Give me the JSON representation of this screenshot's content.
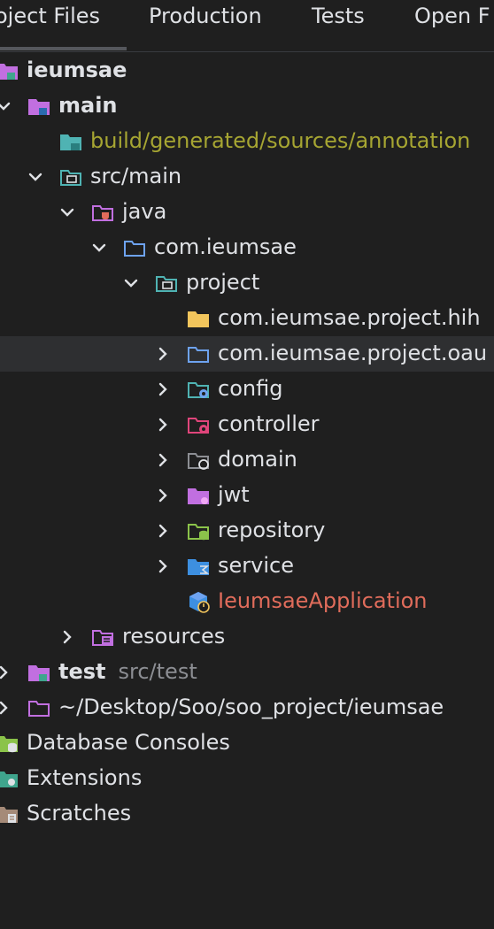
{
  "tabs": [
    "oject Files",
    "Production",
    "Tests",
    "Open F"
  ],
  "tree": {
    "ieumsae": "ieumsae",
    "main": "main",
    "build_generated": "build/generated/sources/annotation",
    "src_main": "src/main",
    "java": "java",
    "com_ieumsae": "com.ieumsae",
    "project": "project",
    "pkg_hih": "com.ieumsae.project.hih",
    "pkg_oau": "com.ieumsae.project.oau",
    "config": "config",
    "controller": "controller",
    "domain": "domain",
    "jwt": "jwt",
    "repository": "repository",
    "service": "service",
    "app_class": "IeumsaeApplication",
    "resources": "resources",
    "test": "test",
    "test_path": "src/test",
    "desktop_path": "~/Desktop/Soo/soo_project/ieumsae",
    "database_consoles": "Database Consoles",
    "extensions": "Extensions",
    "scratches": "Scratches"
  },
  "colors": {
    "background": "#1f1f1f",
    "text": "#dfe1e5",
    "module_folder": "#c16fe0",
    "source_folder": "#4fb3b3",
    "package_folder": "#6ea3f0",
    "generated_text": "#a6a532",
    "error_text": "#e06c5b"
  }
}
